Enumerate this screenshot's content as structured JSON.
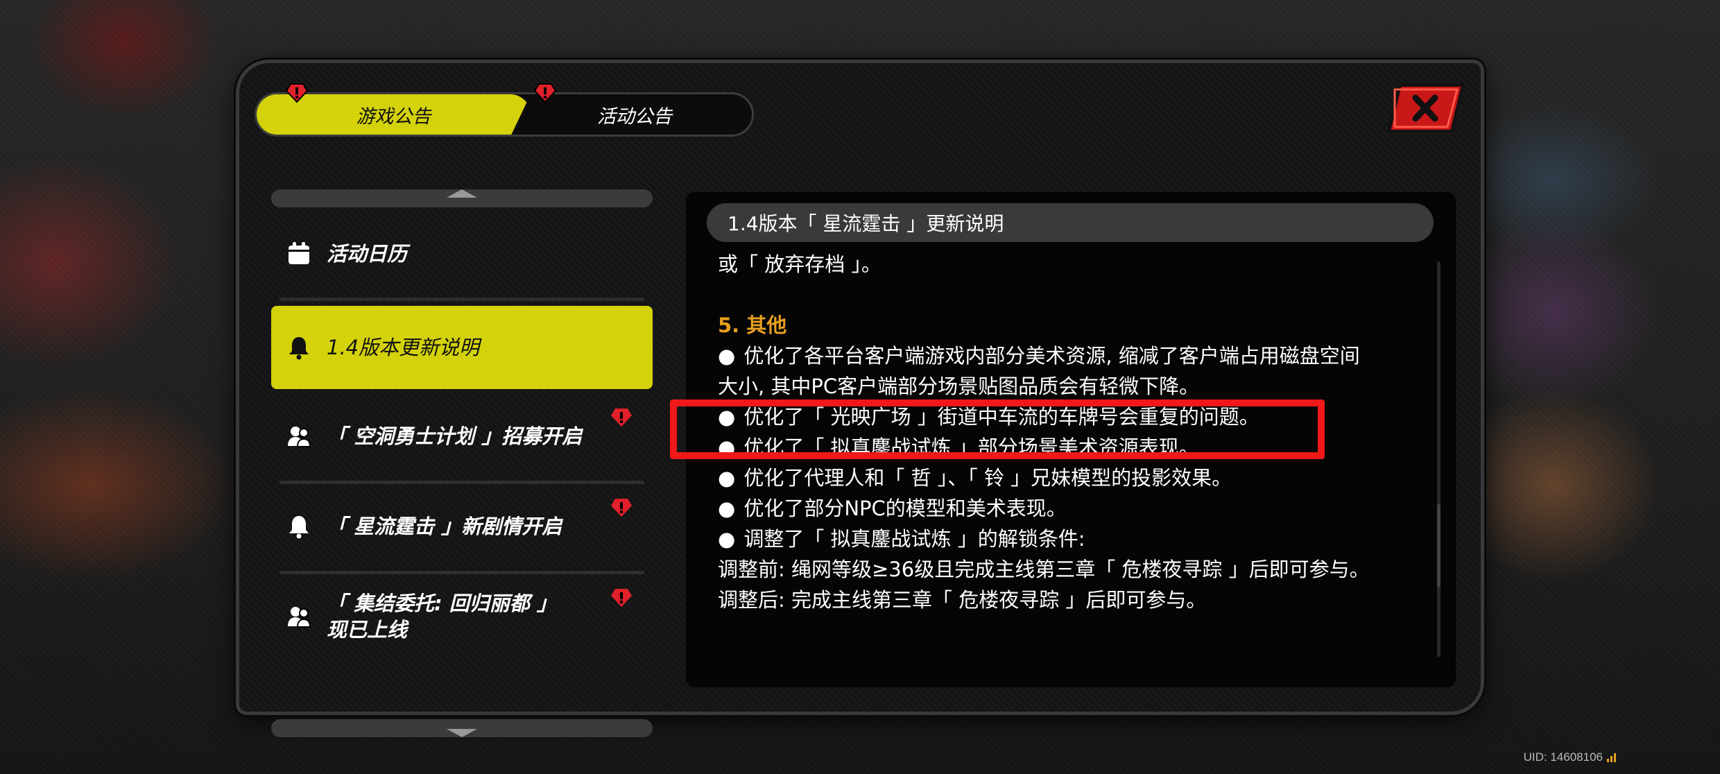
{
  "tabs": [
    {
      "label": "游戏公告",
      "active": true
    },
    {
      "label": "活动公告",
      "active": false
    }
  ],
  "close": {
    "icon": "close-icon"
  },
  "sidebar": {
    "items": [
      {
        "label": "活动日历",
        "icon": "calendar-icon"
      },
      {
        "label": "1.4版本更新说明",
        "icon": "bell-icon",
        "active": true
      },
      {
        "label": "「 空洞勇士计划 」招募开启",
        "icon": "handshake-icon",
        "alert": true
      },
      {
        "label": "「 星流霆击 」新剧情开启",
        "icon": "bell-icon",
        "alert": true
      },
      {
        "label_line1": "「 集结委托: 回归丽都 」",
        "label_line2": "现已上线",
        "icon": "handshake-icon",
        "alert": true
      }
    ]
  },
  "content": {
    "title": "1.4版本「 星流霆击 」更新说明",
    "lines": [
      {
        "type": "text",
        "text": "或「 放弃存档 」。"
      },
      {
        "type": "blank",
        "text": ""
      },
      {
        "type": "heading",
        "text": "5. 其他"
      },
      {
        "type": "bullet",
        "text": "优化了各平台客户端游戏内部分美术资源, 缩减了客户端占用磁盘空间"
      },
      {
        "type": "text",
        "text": "大小, 其中PC客户端部分场景贴图品质会有轻微下降。"
      },
      {
        "type": "bullet",
        "text": "优化了「 光映广场 」街道中车流的车牌号会重复的问题。"
      },
      {
        "type": "bullet",
        "text": "优化了「 拟真鏖战试炼 」部分场景美术资源表现。"
      },
      {
        "type": "bullet",
        "text": "优化了代理人和「 哲 」、「 铃 」兄妹模型的投影效果。"
      },
      {
        "type": "bullet",
        "text": "优化了部分NPC的模型和美术表现。"
      },
      {
        "type": "bullet",
        "text": "调整了「 拟真鏖战试炼 」的解锁条件:"
      },
      {
        "type": "text",
        "text": "调整前: 绳网等级≥36级且完成主线第三章「 危楼夜寻踪 」后即可参与。"
      },
      {
        "type": "text",
        "text": "调整后: 完成主线第三章「 危楼夜寻踪 」后即可参与。"
      }
    ]
  },
  "footer": {
    "uid": "UID: 14608106"
  },
  "colors": {
    "accent": "#d4d20a",
    "heading": "#e8a020",
    "highlight": "#f01818",
    "alert": "#e0202a"
  }
}
